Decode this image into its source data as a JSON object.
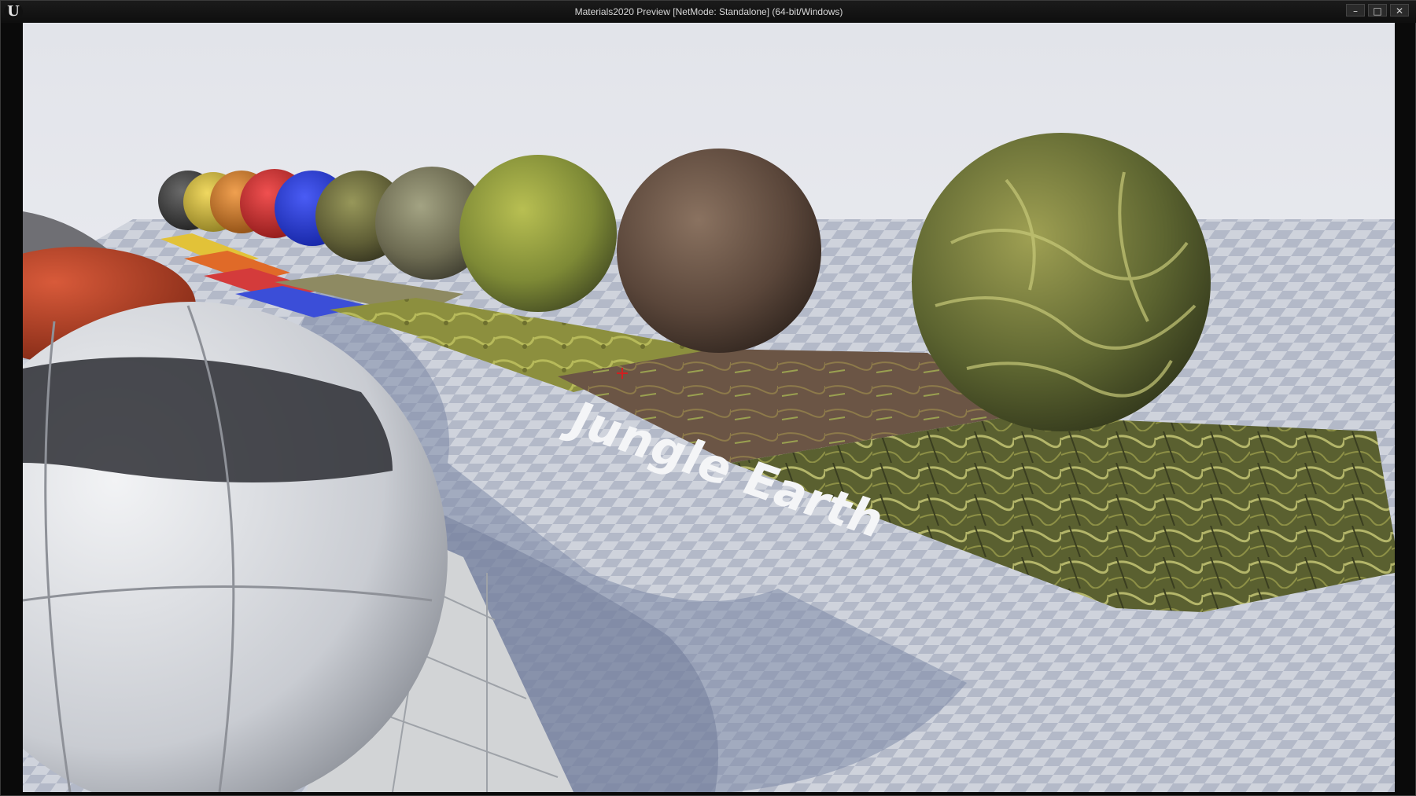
{
  "window": {
    "title": "Materials2020 Preview [NetMode: Standalone] (64-bit/Windows)",
    "controls": {
      "minimize_icon": "minimize-icon",
      "maximize_icon": "maximize-icon",
      "close_icon": "close-icon"
    }
  },
  "scene": {
    "exhibit_label": "Jungle Earth",
    "crosshair_icon": "crosshair-icon"
  }
}
